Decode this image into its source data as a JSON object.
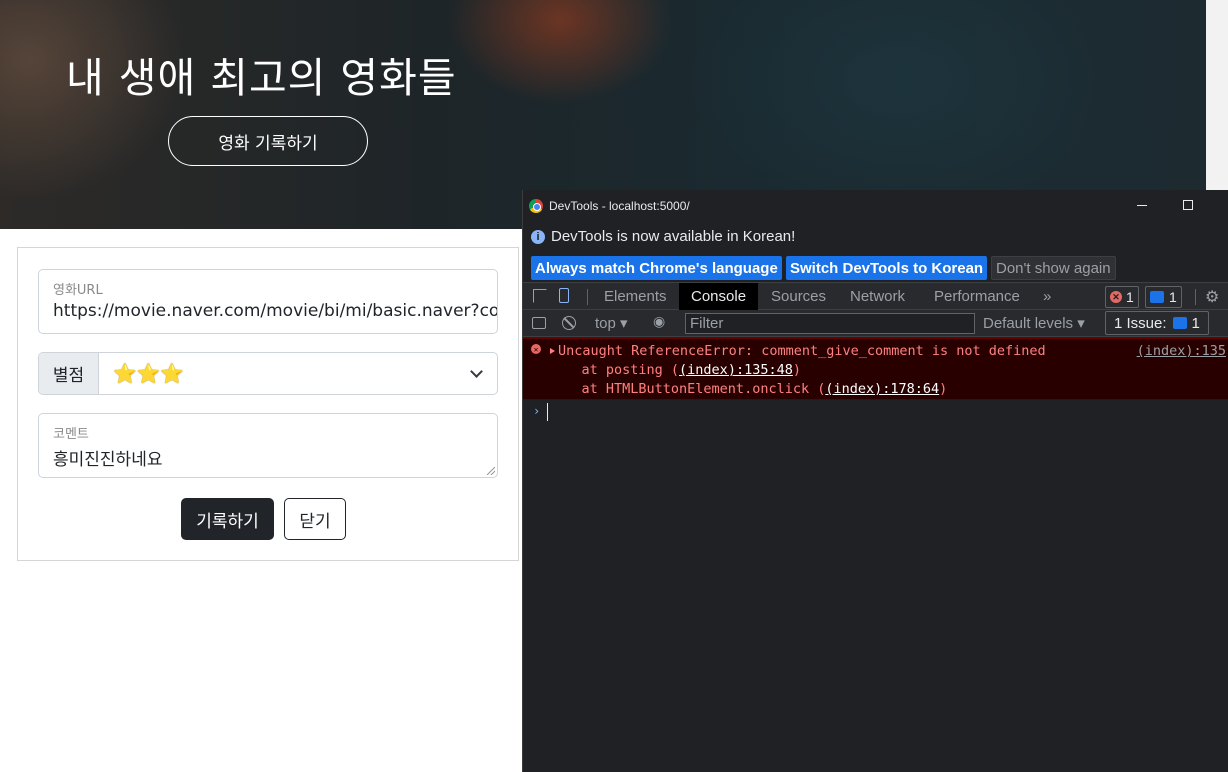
{
  "hero": {
    "title": "내 생애 최고의 영화들",
    "record_button": "영화 기록하기"
  },
  "form": {
    "url_label": "영화URL",
    "url_value": "https://movie.naver.com/movie/bi/mi/basic.naver?code=",
    "rating_label": "별점",
    "rating_value": "⭐⭐⭐",
    "comment_label": "코멘트",
    "comment_value": "흥미진진하네요",
    "submit_button": "기록하기",
    "close_button": "닫기"
  },
  "devtools": {
    "window_title": "DevTools - localhost:5000/",
    "info_message": "DevTools is now available in Korean!",
    "info_buttons": [
      "Always match Chrome's language",
      "Switch DevTools to Korean",
      "Don't show again"
    ],
    "tabs": [
      "Elements",
      "Console",
      "Sources",
      "Network",
      "Performance"
    ],
    "more_tabs": "»",
    "error_count": "1",
    "message_count": "1",
    "filter": {
      "context": "top ▾",
      "placeholder": "Filter",
      "levels": "Default levels ▾",
      "issues_label": "1 Issue:",
      "issues_count": "1"
    },
    "console": {
      "error_message": "Uncaught ReferenceError: comment_give_comment is not defined",
      "error_source": "(index):135",
      "stack1_prefix": "    at posting (",
      "stack1_link": "(index):135:48",
      "stack1_suffix": ")",
      "stack2_prefix": "    at HTMLButtonElement.onclick (",
      "stack2_link": "(index):178:64",
      "stack2_suffix": ")",
      "prompt": "›"
    }
  },
  "colors": {
    "accent": "#1a73e8",
    "error_bg": "#290000",
    "error_text": "#ff8080",
    "dark_button": "#212529"
  }
}
